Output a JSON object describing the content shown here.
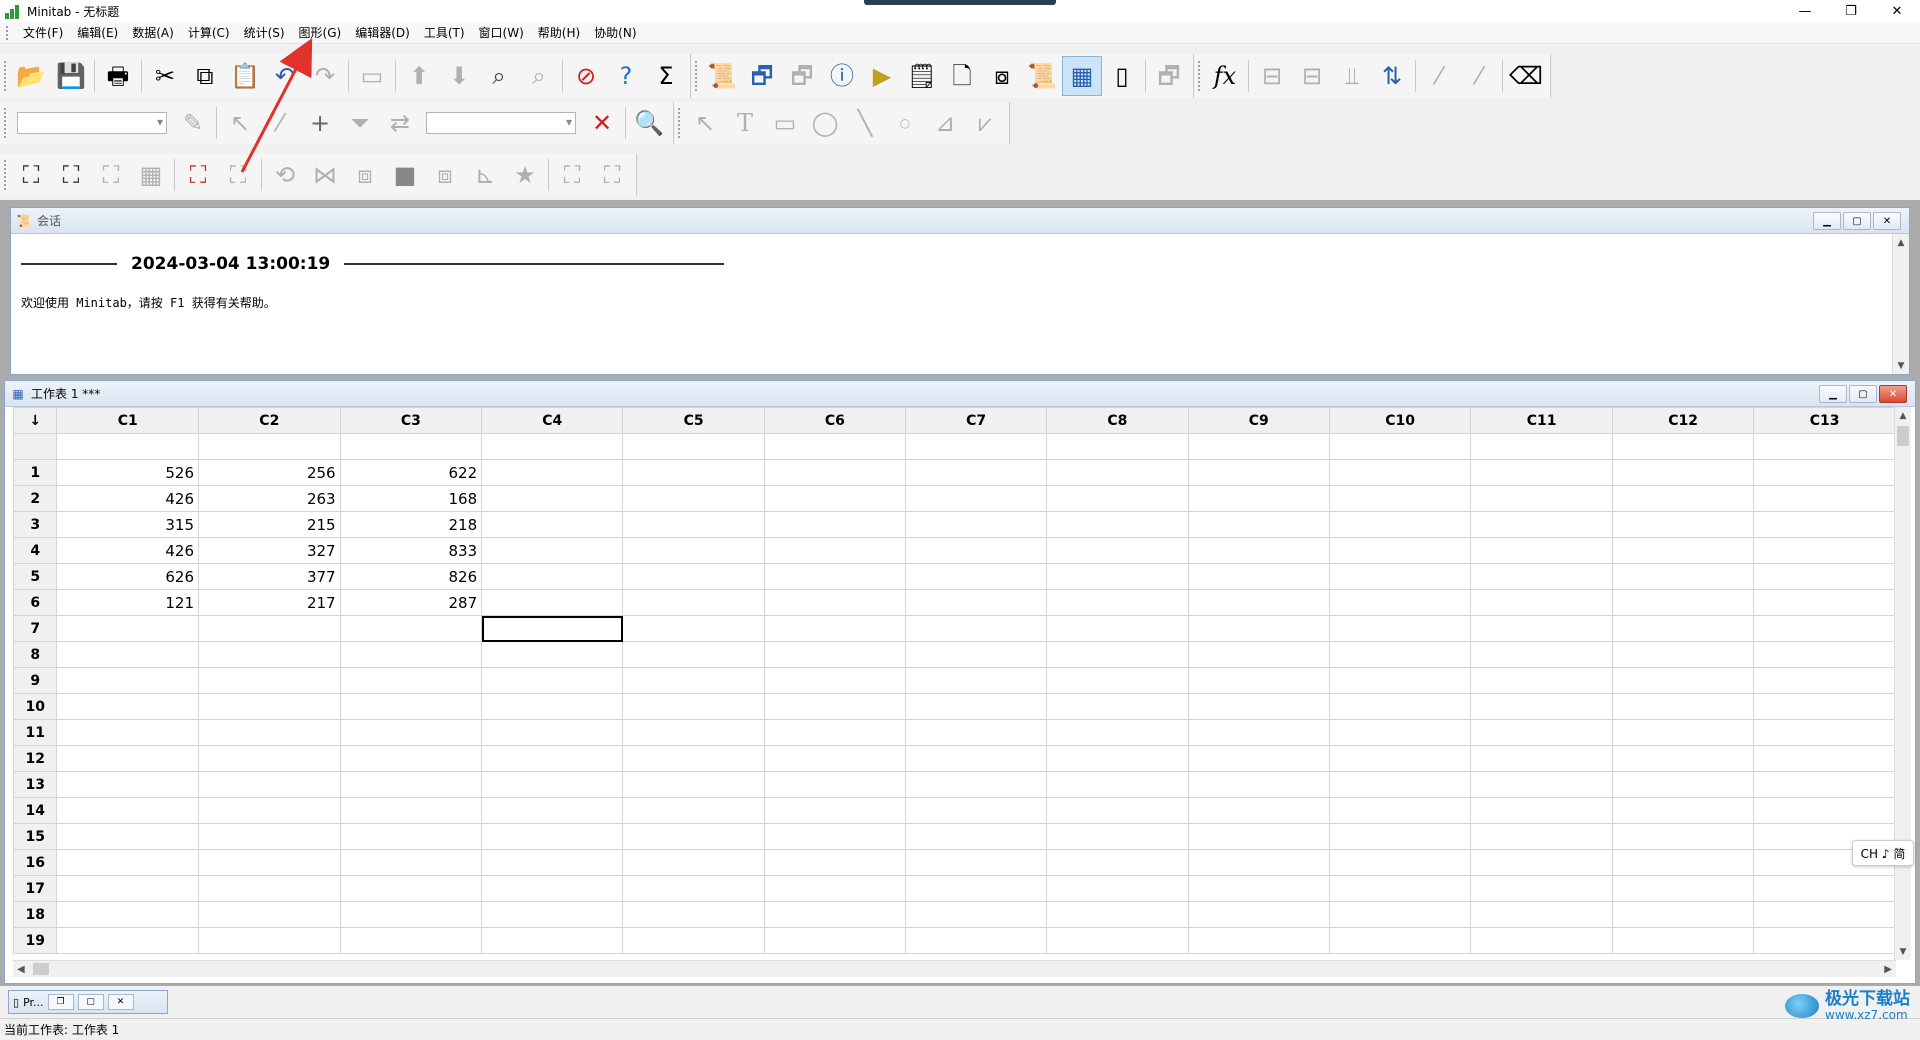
{
  "window": {
    "title": "Minitab - 无标题",
    "minimize": "—",
    "restore": "❐",
    "close": "✕"
  },
  "menu": [
    "文件(F)",
    "编辑(E)",
    "数据(A)",
    "计算(C)",
    "统计(S)",
    "图形(G)",
    "编辑器(D)",
    "工具(T)",
    "窗口(W)",
    "帮助(H)",
    "协助(N)"
  ],
  "session": {
    "title": "会话",
    "datetime": "2024-03-04 13:00:19",
    "welcome": "欢迎使用 Minitab，请按 F1 获得有关帮助。"
  },
  "worksheet": {
    "title": "工作表 1 ***",
    "corner": "↓",
    "columns": [
      "C1",
      "C2",
      "C3",
      "C4",
      "C5",
      "C6",
      "C7",
      "C8",
      "C9",
      "C10",
      "C11",
      "C12",
      "C13"
    ],
    "row_labels": [
      "1",
      "2",
      "3",
      "4",
      "5",
      "6",
      "7",
      "8",
      "9",
      "10",
      "11",
      "12",
      "13",
      "14",
      "15",
      "16",
      "17",
      "18",
      "19"
    ],
    "data": [
      [
        "526",
        "256",
        "622"
      ],
      [
        "426",
        "263",
        "168"
      ],
      [
        "315",
        "215",
        "218"
      ],
      [
        "426",
        "327",
        "833"
      ],
      [
        "626",
        "377",
        "826"
      ],
      [
        "121",
        "217",
        "287"
      ]
    ]
  },
  "minimized_window": {
    "label": "Pr..."
  },
  "status": {
    "text": "当前工作表: 工作表 1"
  },
  "ime": {
    "label": "CH ♪ 简"
  },
  "watermark": {
    "title": "极光下载站",
    "url": "www.xz7.com"
  },
  "colors": {
    "accent_arrow": "#e0322a",
    "title_gradient_top": "#eef3fa",
    "title_gradient_bottom": "#d9e3f1"
  }
}
